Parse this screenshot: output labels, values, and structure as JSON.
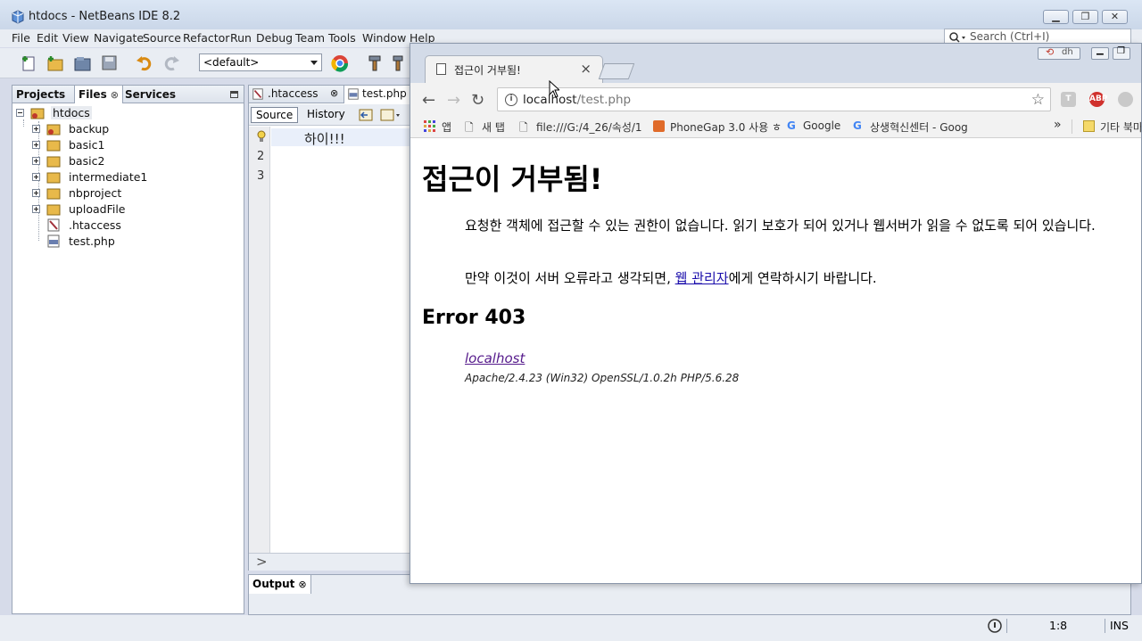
{
  "netbeans": {
    "title": "htdocs - NetBeans IDE 8.2",
    "menu": [
      "File",
      "Edit",
      "View",
      "Navigate",
      "Source",
      "Refactor",
      "Run",
      "Debug",
      "Team",
      "Tools",
      "Window",
      "Help"
    ],
    "search_placeholder": "Search (Ctrl+I)",
    "config_combo": "<default>",
    "panel_tabs": {
      "projects": "Projects",
      "files": "Files",
      "services": "Services"
    },
    "tree": {
      "root": "htdocs",
      "items": [
        "backup",
        "basic1",
        "basic2",
        "intermediate1",
        "nbproject",
        "uploadFile",
        ".htaccess",
        "test.php"
      ]
    },
    "editor": {
      "tabs": [
        ".htaccess",
        "test.php"
      ],
      "source_btn": "Source",
      "history_btn": "History",
      "line_numbers": [
        "2",
        "3"
      ],
      "code_line1": "하이!!!"
    },
    "output_tab": "Output",
    "status": {
      "position": "1:8",
      "mode": "INS"
    }
  },
  "chrome": {
    "tab_title": "접근이 거부됨!",
    "url_host": "localhost",
    "url_path": "/test.php",
    "bookmarks": {
      "apps": "앱",
      "new_tab": "새 탭",
      "file": "file:///G:/4_26/속성/1",
      "phonegap": "PhoneGap 3.0 사용 ㅎ",
      "google": "Google",
      "sangsaeng": "상생혁신센터 - Goog",
      "more": "»",
      "other": "기타 북마"
    },
    "page": {
      "heading": "접근이 거부됨!",
      "para1": "요청한 객체에 접근할 수 있는 권한이 없습니다. 읽기 보호가 되어 있거나 웹서버가 읽을 수 없도록 되어 있습니다.",
      "para2_before": "만약 이것이 서버 오류라고 생각되면, ",
      "para2_link": "웹 관리자",
      "para2_after": "에게 연락하시기 바랍니다.",
      "error_heading": "Error 403",
      "host_link": "localhost",
      "server_sig": "Apache/2.4.23 (Win32) OpenSSL/1.0.2h PHP/5.6.28"
    }
  }
}
